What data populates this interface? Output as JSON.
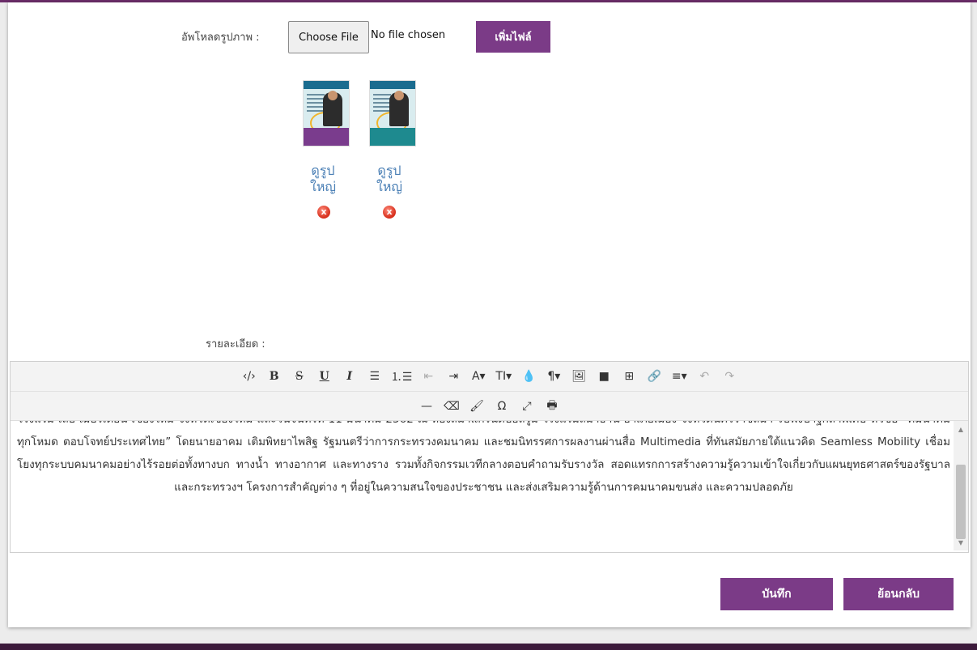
{
  "upload": {
    "label": "อัพโหลดรูปภาพ :",
    "choose_file_label": "Choose File",
    "file_status": "No file chosen",
    "add_file_label": "เพิ่มไฟล์"
  },
  "images": [
    {
      "view_label": "ดูรูปใหญ่",
      "delete_icon": "x"
    },
    {
      "view_label": "ดูรูปใหญ่",
      "delete_icon": "x"
    }
  ],
  "detail": {
    "label": "รายละเอียด :"
  },
  "toolbar": {
    "row1": [
      "‹/›",
      "B",
      "S",
      "U",
      "I",
      "☰",
      "⒈☰",
      "⇤",
      "⇥",
      "A▾",
      "TI▾",
      "💧",
      "¶▾",
      "🖼",
      "■",
      "⊞",
      "🔗",
      "≡▾",
      "↶",
      "↷"
    ],
    "row2": [
      "—",
      "⌫",
      "🖌",
      "Ω",
      "⤢",
      "🖶"
    ]
  },
  "editor": {
    "content": "โรงแรม เลอ เมอริเดียน เชียงใหม่ จังหวัดเชียงใหม่ และวันจันทร์ที่ 11 มีนาคม 2562 ณ ห้องสมาแกรนด์บอลรูม โรงแรมสีมาธานี อำเภอเมือง จังหวัดนครราชสีมา รับฟังปาฐกถาพิเศษ หัวข้อ “คมนาคมทุกโหมด ตอบโจทย์ประเทศไทย” โดยนายอาคม เติมพิทยาไพสิฐ รัฐมนตรีว่าการกระทรวงคมนาคม และชมนิทรรศการผลงานผ่านสื่อ Multimedia ที่ทันสมัยภายใต้แนวคิด Seamless Mobility เชื่อมโยงทุกระบบคมนาคมอย่างไร้รอยต่อทั้งทางบก ทางน้ำ ทางอากาศ และทางราง รวมทั้งกิจกรรมเวทีกลางตอบคำถามรับรางวัล สอดแทรกการสร้างความรู้ความเข้าใจเกี่ยวกับแผนยุทธศาสตร์ของรัฐบาล และกระทรวงฯ โครงการสำคัญต่าง ๆ ที่อยู่ในความสนใจของประชาชน และส่งเสริมความรู้ด้านการคมนาคมขนส่ง และความปลอดภัย"
  },
  "actions": {
    "save_label": "บันทึก",
    "back_label": "ย้อนกลับ"
  }
}
